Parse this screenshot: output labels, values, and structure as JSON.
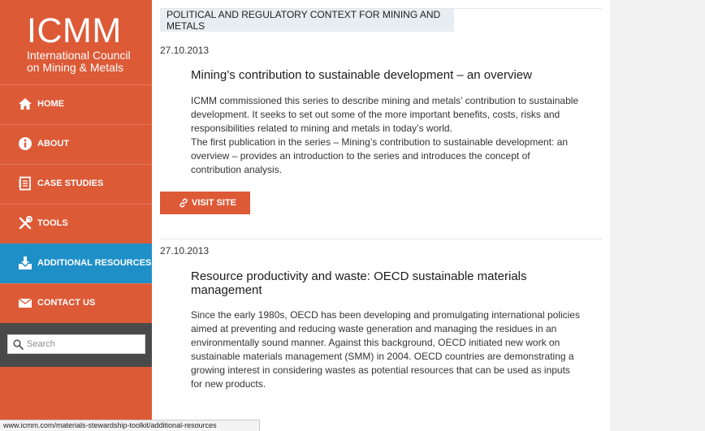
{
  "logo": {
    "main": "ICMM",
    "line1": "International Council",
    "line2": "on Mining & Metals"
  },
  "nav": [
    {
      "label": "HOME",
      "icon": "home-icon"
    },
    {
      "label": "ABOUT",
      "icon": "info-icon"
    },
    {
      "label": "CASE STUDIES",
      "icon": "document-icon"
    },
    {
      "label": "TOOLS",
      "icon": "tools-icon"
    },
    {
      "label": "ADDITIONAL RESOURCES",
      "icon": "download-icon",
      "active": true
    },
    {
      "label": "CONTACT US",
      "icon": "envelope-icon"
    }
  ],
  "search": {
    "placeholder": "Search",
    "value": ""
  },
  "section": {
    "title": "POLITICAL AND REGULATORY CONTEXT FOR MINING AND METALS"
  },
  "articles": [
    {
      "date": "27.10.2013",
      "title": "Mining’s contribution to sustainable development – an overview",
      "paragraphs": [
        "ICMM commissioned this series to describe mining and metals’ contribution to sustainable development. It seeks to set out some of the more important benefits, costs, risks and responsibilities related to mining and metals in today’s world.",
        "The first publication in the series – Mining’s contribution to sustainable development: an overview – provides an introduction to the series and introduces the concept of contribution analysis."
      ],
      "button": "VISIT SITE"
    },
    {
      "date": "27.10.2013",
      "title": "Resource productivity and waste: OECD sustainable materials management",
      "paragraphs": [
        "Since the early 1980s, OECD has been developing and promulgating international policies aimed at preventing and reducing waste generation and managing the residues in an environmentally sound manner. Against this background, OECD initiated new work on sustainable materials management (SMM) in 2004. OECD countries are demonstrating a growing interest in considering wastes as potential resources that can be used as inputs for new products."
      ]
    }
  ],
  "status_bar": {
    "url": "www.icmm.com/materials-stewardship-toolkit/additional-resources"
  },
  "colors": {
    "brand": "#dd5a37",
    "active": "#1f8fc8",
    "search_bg": "#4a4a4a"
  }
}
